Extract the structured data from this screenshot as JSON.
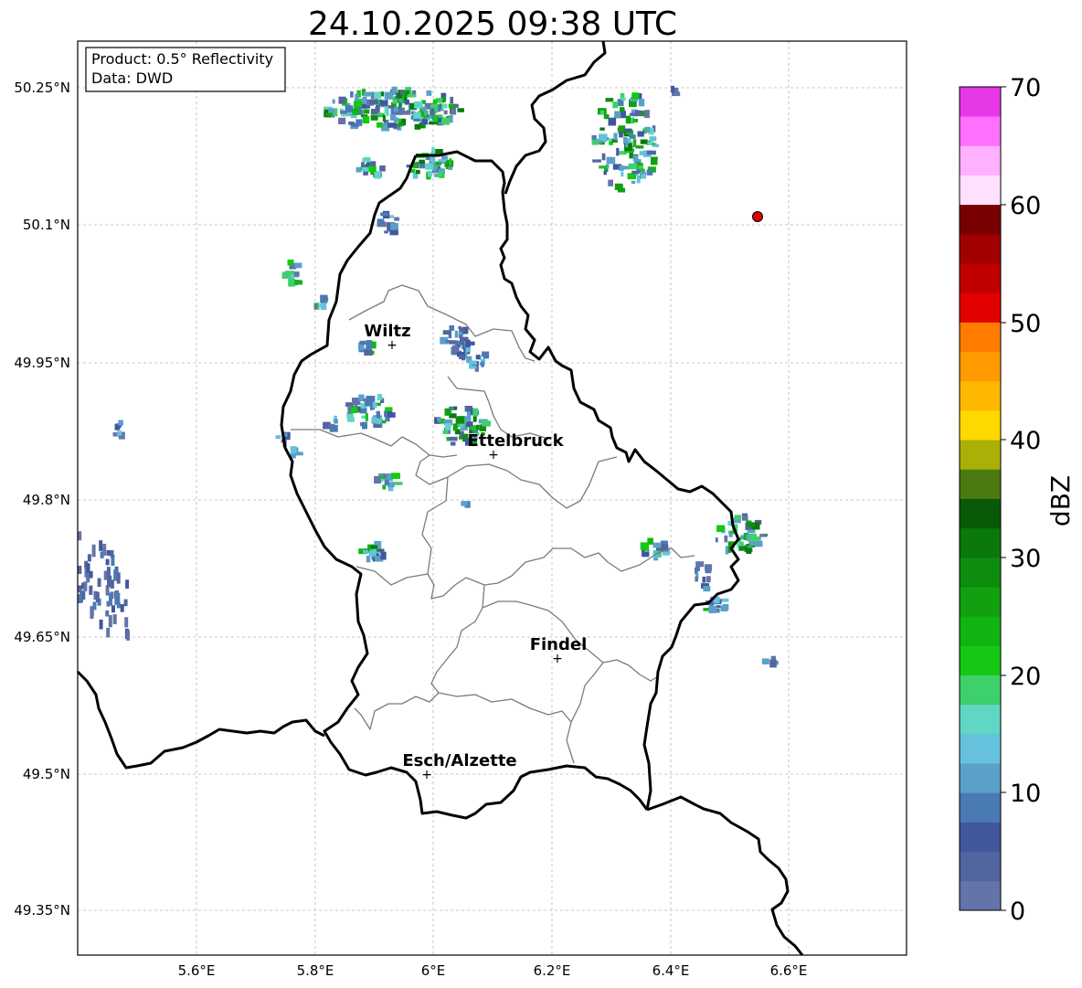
{
  "map": {
    "title": "24.10.2025 09:38 UTC",
    "info_product": "Product: 0.5° Reflectivity",
    "info_data": "Data: DWD",
    "lon_ticks": [
      "5.6°E",
      "5.8°E",
      "6°E",
      "6.2°E",
      "6.4°E",
      "6.6°E"
    ],
    "lat_ticks": [
      "50.25°N",
      "50.1°N",
      "49.95°N",
      "49.8°N",
      "49.65°N",
      "49.5°N",
      "49.35°N"
    ],
    "cities": [
      {
        "name": "Wiltz",
        "lon": 5.93,
        "lat": 49.97
      },
      {
        "name": "Ettelbruck",
        "lon": 6.1,
        "lat": 49.85
      },
      {
        "name": "Findel",
        "lon": 6.21,
        "lat": 49.627
      },
      {
        "name": "Esch/Alzette",
        "lon": 5.99,
        "lat": 49.5
      }
    ],
    "marker": {
      "lon": 6.545,
      "lat": 50.11,
      "color": "#dd0000"
    }
  },
  "colorbar": {
    "label": "dBZ",
    "ticks": [
      "0",
      "10",
      "20",
      "30",
      "40",
      "50",
      "60",
      "70"
    ],
    "colors": [
      "#6474a8",
      "#52659f",
      "#40579c",
      "#4a7ab4",
      "#5aa0c8",
      "#66c2dc",
      "#60d6c4",
      "#3ed06a",
      "#14c814",
      "#12b412",
      "#10a010",
      "#0e8c0e",
      "#0a780a",
      "#085a08",
      "#4c7a10",
      "#aab008",
      "#ffd800",
      "#ffb800",
      "#ff9a00",
      "#ff7c00",
      "#e20000",
      "#c00000",
      "#a00000",
      "#780000",
      "#ffe0ff",
      "#ffb0ff",
      "#ff70ff",
      "#e638e6"
    ]
  }
}
